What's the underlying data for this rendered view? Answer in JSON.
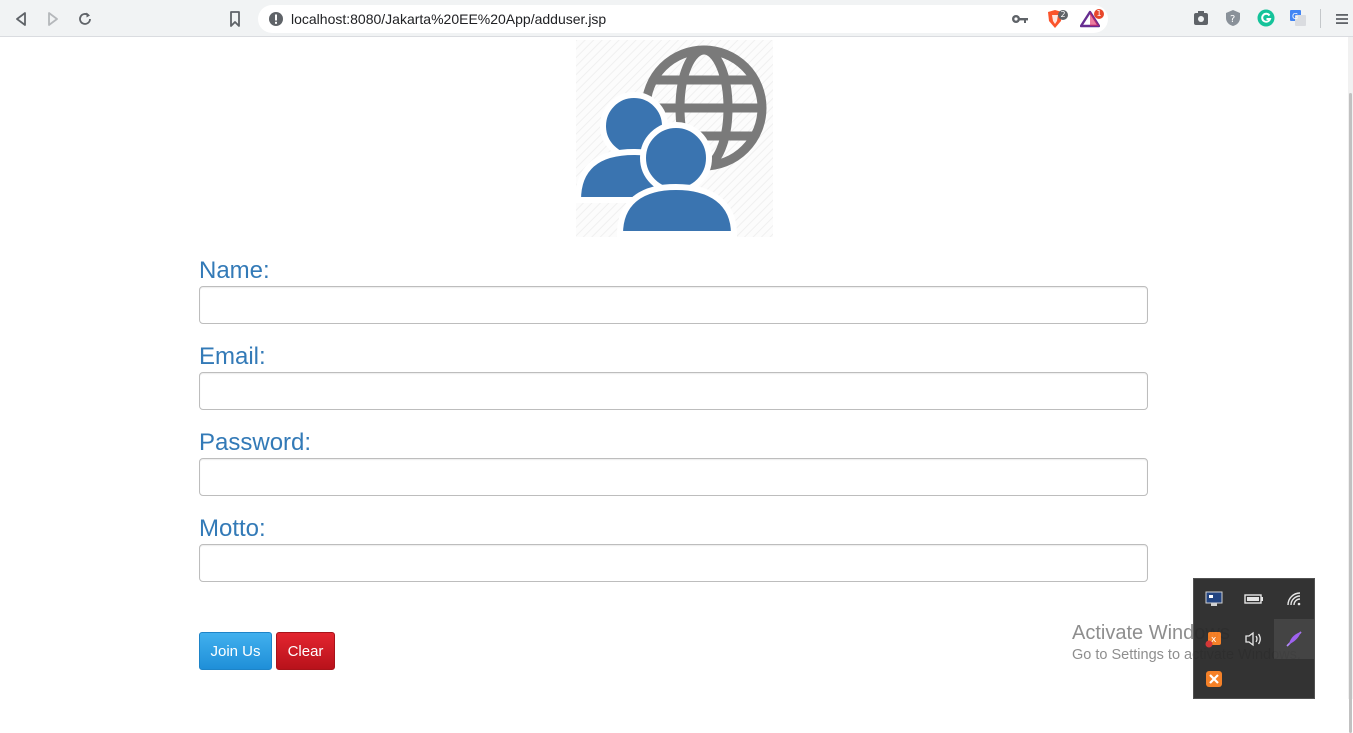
{
  "browser": {
    "url": "localhost:8080/Jakarta%20EE%20App/adduser.jsp",
    "extensions": [
      {
        "name": "brave-shields-icon",
        "badge": "2"
      },
      {
        "name": "brave-rewards-icon",
        "badge": "1"
      }
    ]
  },
  "form": {
    "fields": [
      {
        "label": "Name:",
        "value": "",
        "placeholder": ""
      },
      {
        "label": "Email:",
        "value": "",
        "placeholder": ""
      },
      {
        "label": "Password:",
        "value": "",
        "placeholder": ""
      },
      {
        "label": "Motto:",
        "value": "",
        "placeholder": ""
      }
    ],
    "join_label": "Join Us",
    "clear_label": "Clear"
  },
  "watermark": {
    "title": "Activate Windows",
    "subtitle": "Go to Settings to activate Windows."
  },
  "tray_icons": [
    "monitor-icon",
    "battery-icon",
    "network-icon",
    "xampp-warning-icon",
    "volume-icon",
    "feather-pen-icon",
    "xampp-icon"
  ],
  "colors": {
    "label": "#337ab7",
    "join_button": "#2a9fe2",
    "clear_button": "#cc1a23",
    "logo_people": "#3a74b0",
    "logo_globe": "#7a7a7a"
  }
}
